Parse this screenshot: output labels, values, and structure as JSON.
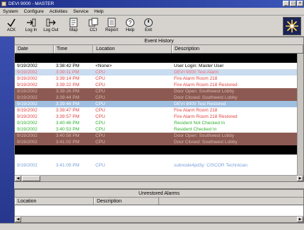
{
  "window": {
    "title": "DEVI 9000 - MASTER",
    "controls": [
      "_",
      "□",
      "×"
    ]
  },
  "menu": [
    "System",
    "Configure",
    "Activities",
    "Service",
    "Help"
  ],
  "toolbar": [
    {
      "label": "ACK",
      "icon": "check-icon"
    },
    {
      "label": "Log In",
      "icon": "login-icon"
    },
    {
      "label": "Log Out",
      "icon": "logout-icon"
    },
    {
      "label": "Map",
      "icon": "map-icon"
    },
    {
      "label": "CCI",
      "icon": "cci-icon"
    },
    {
      "label": "Report",
      "icon": "report-icon"
    },
    {
      "label": "Help",
      "icon": "help-icon"
    },
    {
      "label": "Exit",
      "icon": "exit-icon"
    }
  ],
  "event_history": {
    "title": "Event History",
    "columns": [
      "Date",
      "Time",
      "Location",
      "Description"
    ],
    "rows": [
      {
        "date": "9/19/2002",
        "time": "3:38:42 PM",
        "location": "<None>",
        "description": "User Login: Master User",
        "fg": "#000000",
        "bg": "#ffffff"
      },
      {
        "date": "9/19/2002",
        "time": "3:39:11 PM",
        "location": "CPU",
        "description": "DEVI 9000 Test Alarm",
        "fg": "#ff6a6a",
        "bg": "#c9dcf0"
      },
      {
        "date": "9/19/2002",
        "time": "3:39:14 PM",
        "location": "CPU",
        "description": "Fire Alarm Room 218",
        "fg": "#e04040",
        "bg": "#ffffff"
      },
      {
        "date": "9/19/2002",
        "time": "3:39:22 PM",
        "location": "CPU",
        "description": "Fire Alarm Room 218 Restored",
        "fg": "#e04040",
        "bg": "#ffffff"
      },
      {
        "date": "9/19/2002",
        "time": "3:39:26 PM",
        "location": "CPU",
        "description": "Door Open: Southwest Lobby",
        "fg": "#d8b8b0",
        "bg": "#8c5a52"
      },
      {
        "date": "9/19/2002",
        "time": "3:39:44 PM",
        "location": "CPU",
        "description": "Door Closed: Southwest Lobby",
        "fg": "#d8b8b0",
        "bg": "#8c5a52"
      },
      {
        "date": "9/19/2002",
        "time": "3:39:46 PM",
        "location": "CPU",
        "description": "DEVI 9000 Test Restored",
        "fg": "#ffffff",
        "bg": "#9fbfe0"
      },
      {
        "date": "9/19/2002",
        "time": "3:39:47 PM",
        "location": "CPU",
        "description": "Fire Alarm Room 218",
        "fg": "#e04040",
        "bg": "#ffffff"
      },
      {
        "date": "9/19/2002",
        "time": "3:39:57 PM",
        "location": "CPU",
        "description": "Fire Alarm Room 218 Restored",
        "fg": "#e04040",
        "bg": "#ffffff"
      },
      {
        "date": "9/19/2002",
        "time": "3:40:46 PM",
        "location": "CPU",
        "description": "Resident Not Checked In",
        "fg": "#30b030",
        "bg": "#ffffff"
      },
      {
        "date": "9/19/2002",
        "time": "3:40:53 PM",
        "location": "CPU",
        "description": "Resident Checked In",
        "fg": "#30b030",
        "bg": "#ffffff"
      },
      {
        "date": "9/19/2002",
        "time": "3:40:58 PM",
        "location": "CPU",
        "description": "Door Open: Southwest Lobby",
        "fg": "#d8b8b0",
        "bg": "#8c5a52"
      },
      {
        "date": "9/19/2002",
        "time": "3:41:02 PM",
        "location": "CPU",
        "description": "Door Closed: Southwest Lobby",
        "fg": "#d8b8b0",
        "bg": "#8c5a52"
      },
      {
        "date": "9/19/2002",
        "time": "3:41:09 PM",
        "location": "CPU",
        "description": "subnode4pd3y: CISCOR Technician",
        "fg": "#7aa0d8",
        "bg": "#ffffff"
      }
    ]
  },
  "unrestored_alarms": {
    "title": "Unrestored Alarms",
    "columns": [
      "Location",
      "Description"
    ]
  },
  "colors": {
    "accent_blue": "#27378c",
    "chrome": "#d6d3ce"
  }
}
